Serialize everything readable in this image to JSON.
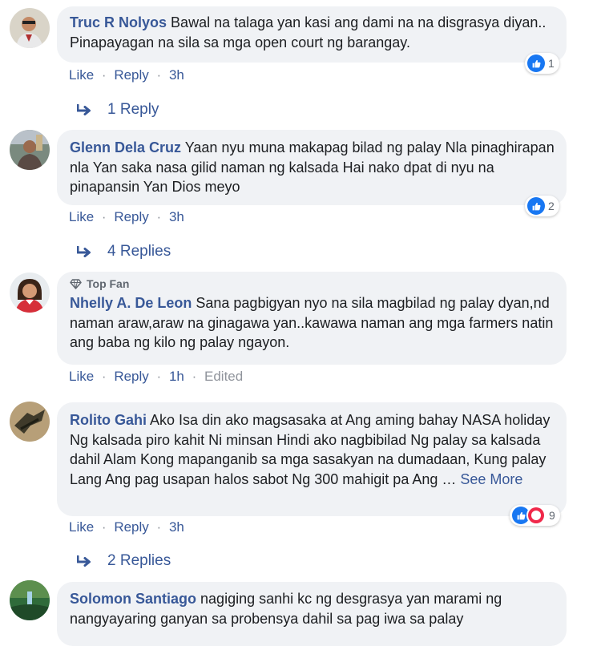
{
  "comments": [
    {
      "author": "Truc R Nolyos",
      "text": "Bawal na talaga yan kasi ang dami na na disgrasya diyan.. Pinapayagan na sila sa mga open court ng barangay.",
      "actions": {
        "like": "Like",
        "reply": "Reply",
        "time": "3h"
      },
      "reaction_count": "1",
      "replies_label": "1 Reply"
    },
    {
      "author": "Glenn Dela Cruz",
      "text": "Yaan nyu muna makapag bilad ng palay Nla pinaghirapan nla Yan saka nasa gilid naman ng kalsada Hai nako dpat di nyu na pinapansin Yan Dios meyo",
      "actions": {
        "like": "Like",
        "reply": "Reply",
        "time": "3h"
      },
      "reaction_count": "2",
      "replies_label": "4 Replies"
    },
    {
      "badge": "Top Fan",
      "author": "Nhelly A. De Leon",
      "text": "Sana pagbigyan nyo na sila magbilad ng palay dyan,nd naman araw,araw na ginagawa yan..kawawa naman ang mga farmers natin ang baba ng kilo ng palay ngayon.",
      "actions": {
        "like": "Like",
        "reply": "Reply",
        "time": "1h",
        "edited": "Edited"
      }
    },
    {
      "author": "Rolito Gahi",
      "text": "Ako Isa din ako magsasaka at Ang aming bahay NASA holiday Ng kalsada piro kahit Ni minsan Hindi ako nagbibilad Ng palay sa kalsada dahil Alam Kong mapanganib sa mga sasakyan na dumadaan, Kung palay Lang Ang pag usapan halos sabot Ng 300 mahigit pa Ang …",
      "see_more": "See More",
      "actions": {
        "like": "Like",
        "reply": "Reply",
        "time": "3h"
      },
      "reaction_count": "9",
      "replies_label": "2 Replies"
    },
    {
      "author": "Solomon Santiago",
      "text": "nagiging sanhi kc ng desgrasya yan marami ng nangyayaring ganyan sa probensya dahil sa pag iwa sa palay"
    }
  ],
  "separator": "·",
  "icons": {
    "like": "like-icon",
    "haha": "haha-icon",
    "reply_arrow": "reply-arrow-icon",
    "diamond": "diamond-icon"
  },
  "colors": {
    "link": "#385898",
    "bubble": "#f0f2f5",
    "like": "#1877f2",
    "haha": "#f0284a"
  }
}
